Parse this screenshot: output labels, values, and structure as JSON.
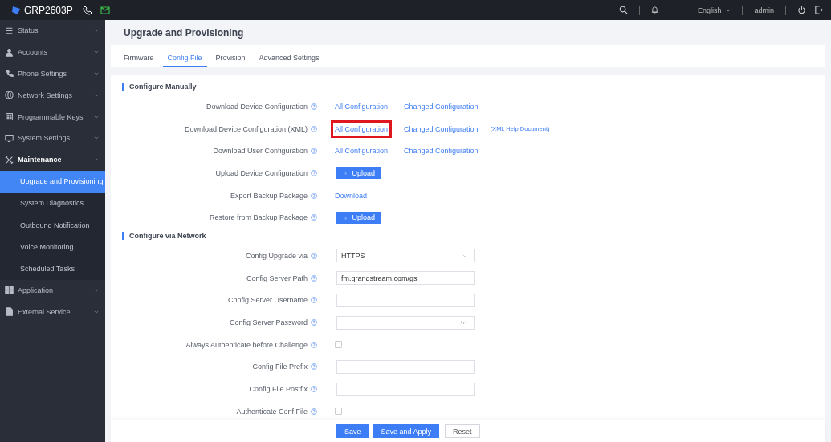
{
  "topbar": {
    "product": "GRP2603P",
    "language": "English",
    "user": "admin"
  },
  "sidebar": {
    "items": [
      {
        "label": "Status",
        "expanded": false
      },
      {
        "label": "Accounts",
        "expanded": false
      },
      {
        "label": "Phone Settings",
        "expanded": false
      },
      {
        "label": "Network Settings",
        "expanded": false
      },
      {
        "label": "Programmable Keys",
        "expanded": false
      },
      {
        "label": "System Settings",
        "expanded": false
      },
      {
        "label": "Maintenance",
        "expanded": true,
        "children": [
          {
            "label": "Upgrade and Provisioning",
            "selected": true
          },
          {
            "label": "System Diagnostics",
            "selected": false
          },
          {
            "label": "Outbound Notification",
            "selected": false
          },
          {
            "label": "Voice Monitoring",
            "selected": false
          },
          {
            "label": "Scheduled Tasks",
            "selected": false
          }
        ]
      },
      {
        "label": "Application",
        "expanded": false
      },
      {
        "label": "External Service",
        "expanded": false
      }
    ]
  },
  "page": {
    "title": "Upgrade and Provisioning"
  },
  "tabs": [
    {
      "label": "Firmware",
      "selected": false
    },
    {
      "label": "Config File",
      "selected": true
    },
    {
      "label": "Provision",
      "selected": false
    },
    {
      "label": "Advanced Settings",
      "selected": false
    }
  ],
  "sections": [
    {
      "title": "Configure Manually",
      "rows": [
        {
          "label": "Download Device Configuration",
          "kind": "links",
          "links": [
            {
              "text": "All Configuration",
              "highlighted": false
            },
            {
              "text": "Changed Configuration",
              "highlighted": false
            }
          ]
        },
        {
          "label": "Download Device Configuration (XML)",
          "kind": "links",
          "links": [
            {
              "text": "All Configuration",
              "highlighted": true
            },
            {
              "text": "Changed Configuration",
              "highlighted": false
            }
          ],
          "help_link": "(XML Help Document)"
        },
        {
          "label": "Download User Configuration",
          "kind": "links",
          "links": [
            {
              "text": "All Configuration",
              "highlighted": false
            },
            {
              "text": "Changed Configuration",
              "highlighted": false
            }
          ]
        },
        {
          "label": "Upload Device Configuration",
          "kind": "upload",
          "button": "Upload"
        },
        {
          "label": "Export Backup Package",
          "kind": "links",
          "links": [
            {
              "text": "Download",
              "highlighted": false
            }
          ]
        },
        {
          "label": "Restore from Backup Package",
          "kind": "upload",
          "button": "Upload"
        }
      ]
    },
    {
      "title": "Configure via Network",
      "rows": [
        {
          "label": "Config Upgrade via",
          "kind": "select",
          "value": "HTTPS"
        },
        {
          "label": "Config Server Path",
          "kind": "input",
          "value": "fm.grandstream.com/gs"
        },
        {
          "label": "Config Server Username",
          "kind": "input",
          "value": ""
        },
        {
          "label": "Config Server Password",
          "kind": "password",
          "value": ""
        },
        {
          "label": "Always Authenticate before Challenge",
          "kind": "checkbox",
          "checked": false
        },
        {
          "label": "Config File Prefix",
          "kind": "input",
          "value": ""
        },
        {
          "label": "Config File Postfix",
          "kind": "input",
          "value": ""
        },
        {
          "label": "Authenticate Conf File",
          "kind": "checkbox",
          "checked": false
        }
      ]
    }
  ],
  "footer": {
    "buttons": [
      {
        "label": "Save",
        "kind": "primary"
      },
      {
        "label": "Save and Apply",
        "kind": "primary"
      },
      {
        "label": "Reset",
        "kind": "plain"
      }
    ]
  }
}
